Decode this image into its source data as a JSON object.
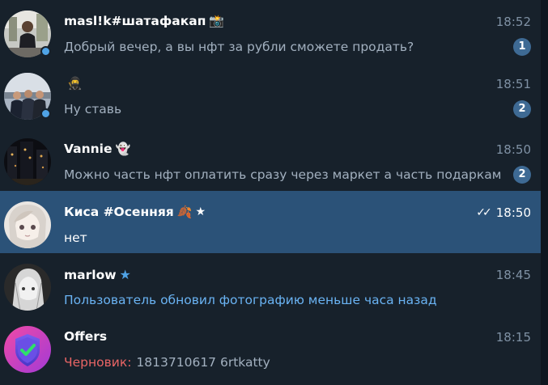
{
  "chats": [
    {
      "name": "masl!k#шатафакап",
      "name_emoji": "📸",
      "time": "18:52",
      "preview": "Добрый вечер, а вы нфт за рубли сможете продать?",
      "unread": "1",
      "online": true
    },
    {
      "name": "",
      "name_emoji": "🥷",
      "time": "18:51",
      "preview": "Ну ставь",
      "unread": "2",
      "online": true
    },
    {
      "name": "Vannie",
      "name_emoji": "👻",
      "time": "18:50",
      "preview": "Можно часть нфт оплатить сразу через маркет а часть подарками?",
      "unread": "2",
      "online": false
    },
    {
      "name": "Киса #Осенняя",
      "name_emoji": "🍂",
      "name_badge": "★",
      "time": "18:50",
      "read_status": "✓✓",
      "preview": "нет",
      "selected": true
    },
    {
      "name": "marlow",
      "name_badge": "★",
      "time": "18:45",
      "preview": "Пользователь обновил фотографию меньше часа назад"
    },
    {
      "name": "Offers",
      "time": "18:15",
      "draft_label": "Черновик:",
      "draft_text": "1813710617 6rtkatty"
    }
  ],
  "colors": {
    "background": "#17212b",
    "selected": "#2b5278",
    "badge": "#3e6a94",
    "online": "#4fa3e6",
    "service_text": "#6ab3f3",
    "draft_label": "#e96565"
  }
}
